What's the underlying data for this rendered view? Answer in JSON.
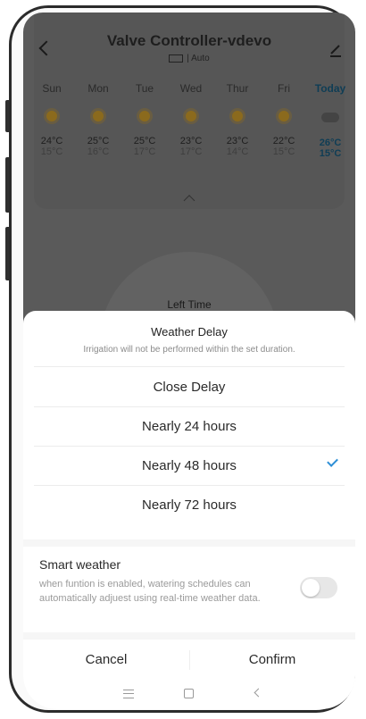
{
  "app": {
    "title": "Valve Controller-vdevo",
    "mode": "| Auto"
  },
  "forecast": [
    {
      "day": "Sun",
      "high": "24°C",
      "low": "15°C",
      "icon": "sun-icon"
    },
    {
      "day": "Mon",
      "high": "25°C",
      "low": "16°C",
      "icon": "sun-icon"
    },
    {
      "day": "Tue",
      "high": "25°C",
      "low": "17°C",
      "icon": "sun-icon"
    },
    {
      "day": "Wed",
      "high": "23°C",
      "low": "17°C",
      "icon": "sun-icon"
    },
    {
      "day": "Thur",
      "high": "23°C",
      "low": "14°C",
      "icon": "sun-icon"
    },
    {
      "day": "Fri",
      "high": "22°C",
      "low": "15°C",
      "icon": "sun-icon"
    },
    {
      "day": "Today",
      "high": "26°C",
      "low": "15°C",
      "icon": "cloud-icon"
    }
  ],
  "background": {
    "left_time_label": "Left Time"
  },
  "sheet": {
    "title": "Weather Delay",
    "description": "Irrigation will not be performed within the set duration.",
    "options": [
      {
        "label": "Close Delay",
        "selected": false
      },
      {
        "label": "Nearly 24 hours",
        "selected": false
      },
      {
        "label": "Nearly 48 hours",
        "selected": true
      },
      {
        "label": "Nearly 72 hours",
        "selected": false
      }
    ],
    "smart_weather": {
      "title": "Smart weather",
      "description": "when funtion is enabled, watering schedules can automatically adjuest using real-time weather data.",
      "enabled": false
    },
    "cancel_label": "Cancel",
    "confirm_label": "Confirm"
  },
  "colors": {
    "accent": "#2e8fd6",
    "today_text": "#0f3d55",
    "overlay": "#5a5a5a"
  }
}
